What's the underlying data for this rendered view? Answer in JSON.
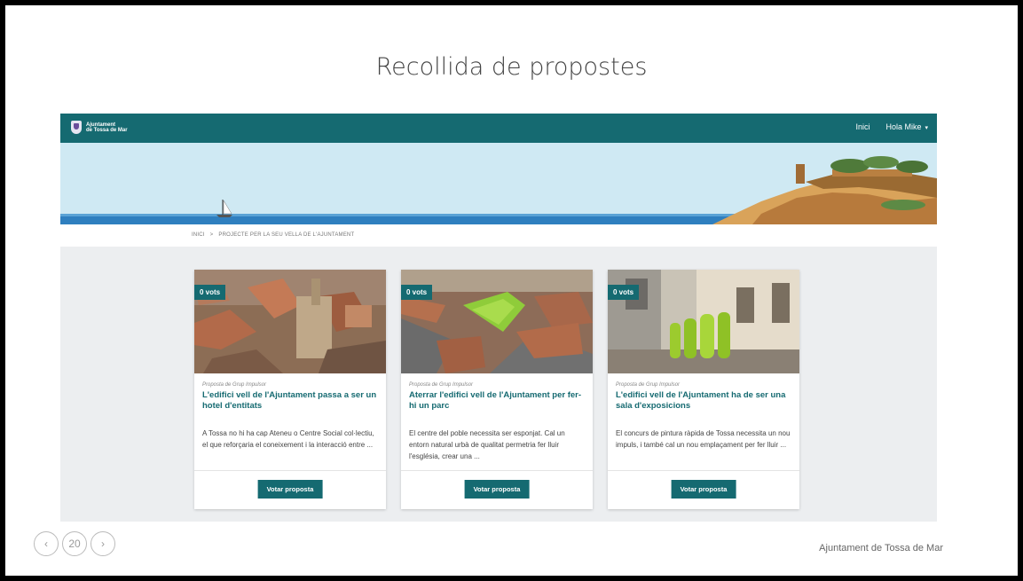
{
  "slide": {
    "title": "Recollida de propostes",
    "page_number": "20",
    "prev_glyph": "‹",
    "next_glyph": "›",
    "footer": "Ajuntament de Tossa de Mar"
  },
  "navbar": {
    "logo_line1": "Ajuntament",
    "logo_line2": "de Tossa de Mar",
    "home_label": "Inici",
    "user_label": "Hola Mike",
    "user_caret": "▾"
  },
  "breadcrumb": {
    "home": "INICI",
    "separator": ">",
    "current": "PROJECTE PER LA SEU VELLA DE L'AJUNTAMENT"
  },
  "cards": [
    {
      "votes": "0 vots",
      "kicker": "Proposta de Grup Impulsor",
      "title": "L'edifici vell de l'Ajuntament passa a ser un hotel d'entitats",
      "description": "A Tossa no hi ha cap Ateneu o Centre Social col·lectiu, el que reforçaria el coneixement i la interacció entre ...",
      "button": "Votar proposta"
    },
    {
      "votes": "0 vots",
      "kicker": "Proposta de Grup Impulsor",
      "title": "Aterrar l'edifici vell de l'Ajuntament per fer-hi un parc",
      "description": "El centre del poble necessita ser esponjat. Cal un entorn natural urbà de qualitat permetria fer lluir l'església, crear una ...",
      "button": "Votar proposta"
    },
    {
      "votes": "0 vots",
      "kicker": "Proposta de Grup Impulsor",
      "title": "L'edifici vell de l'Ajuntament ha de ser una sala d'exposicions",
      "description": "El concurs de pintura ràpida de Tossa necessita un nou impuls, i també cal un nou emplaçament per fer lluir ...",
      "button": "Votar proposta"
    }
  ],
  "colors": {
    "brand": "#156a71",
    "sky": "#cfe9f3",
    "sea": "#2f7fbf"
  }
}
